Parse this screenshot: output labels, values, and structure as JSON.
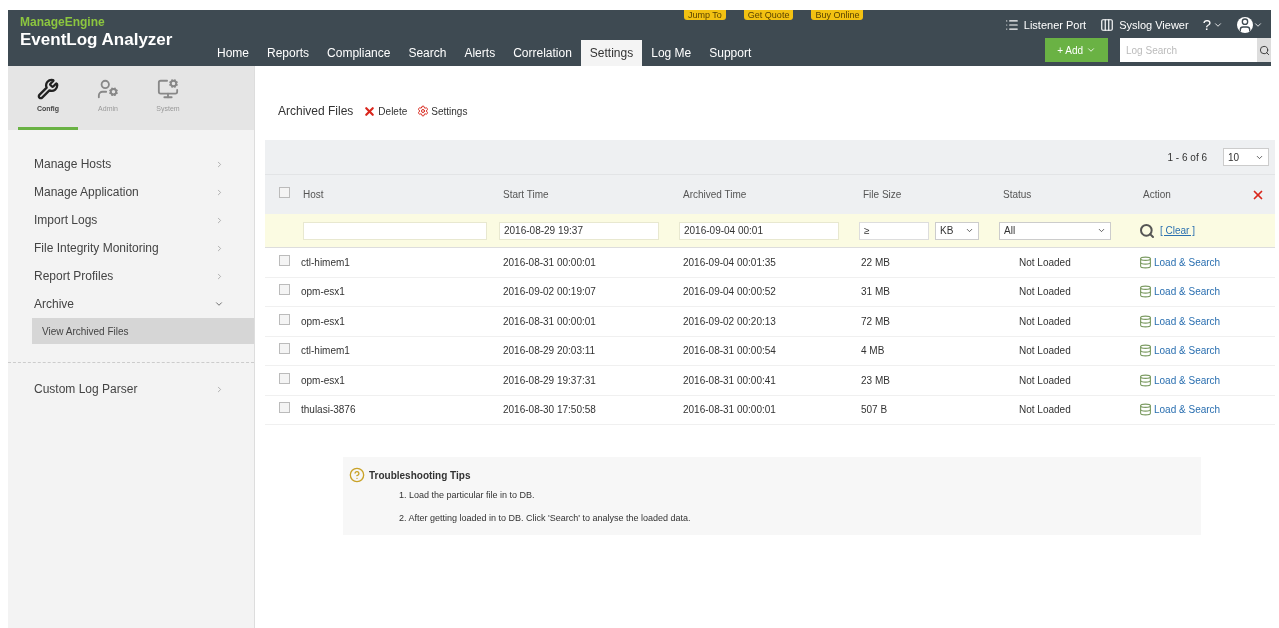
{
  "header": {
    "brand": "ManageEngine",
    "product": "EventLog Analyzer",
    "badges": [
      "Jump To",
      "Get Quote",
      "Buy Online"
    ],
    "links": [
      {
        "kind": "list",
        "label": "Listener Port"
      },
      {
        "kind": "viewer",
        "label": "Syslog Viewer"
      }
    ],
    "help": "?",
    "add_button": "+ Add",
    "search": {
      "placeholder": "Log Search"
    }
  },
  "nav": [
    {
      "label": "Home",
      "selected": false
    },
    {
      "label": "Reports",
      "selected": false
    },
    {
      "label": "Compliance",
      "selected": false
    },
    {
      "label": "Search",
      "selected": false
    },
    {
      "label": "Alerts",
      "selected": false
    },
    {
      "label": "Correlation",
      "selected": false
    },
    {
      "label": "Settings",
      "selected": true
    },
    {
      "label": "Log Me",
      "selected": false
    },
    {
      "label": "Support",
      "selected": false
    }
  ],
  "side_tabs": [
    {
      "kind": "config",
      "label": "Config",
      "selected": true
    },
    {
      "kind": "admin",
      "label": "Admin",
      "selected": false
    },
    {
      "kind": "system",
      "label": "System",
      "selected": false
    }
  ],
  "menu": [
    {
      "label": "Manage Hosts",
      "expanded": false
    },
    {
      "label": "Manage Application",
      "expanded": false
    },
    {
      "label": "Import Logs",
      "expanded": false
    },
    {
      "label": "File Integrity Monitoring",
      "expanded": false
    },
    {
      "label": "Report Profiles",
      "expanded": false
    },
    {
      "label": "Archive",
      "expanded": true,
      "children": [
        {
          "label": "View Archived Files",
          "selected": true
        }
      ]
    },
    {
      "label": "Custom Log Parser",
      "expanded": false
    }
  ],
  "page": {
    "title": "Archived Files",
    "actions": [
      {
        "kind": "delete",
        "label": "Delete"
      },
      {
        "kind": "settings",
        "label": "Settings"
      }
    ]
  },
  "table": {
    "pagination": "1 - 6 of 6",
    "page_size": "10",
    "columns": [
      "Host",
      "Start Time",
      "Archived Time",
      "File Size",
      "Status",
      "Action"
    ],
    "all_checked": false,
    "filters": {
      "start": "2016-08-29 19:37",
      "archived": "2016-09-04 00:01",
      "size": "≥",
      "unit": "KB",
      "status": "All",
      "clear": "[ Clear ]"
    },
    "rows": [
      {
        "host": "ctl-himem1",
        "start": "2016-08-31 00:00:01",
        "archived": "2016-09-04 00:01:35",
        "size": "22 MB",
        "status": "Not Loaded",
        "action": "Load & Search",
        "checked": false
      },
      {
        "host": "opm-esx1",
        "start": "2016-09-02 00:19:07",
        "archived": "2016-09-04 00:00:52",
        "size": "31 MB",
        "status": "Not Loaded",
        "action": "Load & Search",
        "checked": false
      },
      {
        "host": "opm-esx1",
        "start": "2016-08-31 00:00:01",
        "archived": "2016-09-02 00:20:13",
        "size": "72 MB",
        "status": "Not Loaded",
        "action": "Load & Search",
        "checked": false
      },
      {
        "host": "ctl-himem1",
        "start": "2016-08-29 20:03:11",
        "archived": "2016-08-31 00:00:54",
        "size": "4 MB",
        "status": "Not Loaded",
        "action": "Load & Search",
        "checked": false
      },
      {
        "host": "opm-esx1",
        "start": "2016-08-29 19:37:31",
        "archived": "2016-08-31 00:00:41",
        "size": "23 MB",
        "status": "Not Loaded",
        "action": "Load & Search",
        "checked": false
      },
      {
        "host": "thulasi-3876",
        "start": "2016-08-30 17:50:58",
        "archived": "2016-08-31 00:00:01",
        "size": "507 B",
        "status": "Not Loaded",
        "action": "Load & Search",
        "checked": false
      }
    ]
  },
  "tips": {
    "title": "Troubleshooting Tips",
    "items": [
      "1. Load the particular file in to DB.",
      "2. After getting loaded in to DB. Click 'Search' to analyse the loaded data."
    ]
  }
}
